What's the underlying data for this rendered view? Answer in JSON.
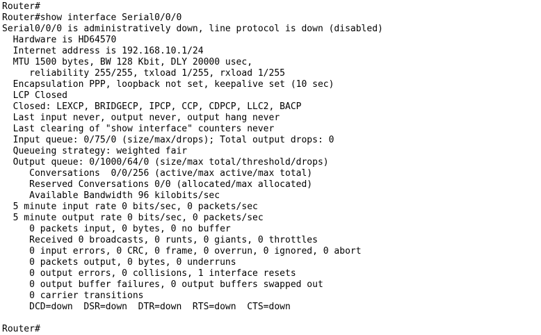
{
  "terminal": {
    "lines": [
      "Router#",
      "Router#show interface Serial0/0/0",
      "Serial0/0/0 is administratively down, line protocol is down (disabled)",
      "  Hardware is HD64570",
      "  Internet address is 192.168.10.1/24",
      "  MTU 1500 bytes, BW 128 Kbit, DLY 20000 usec,",
      "     reliability 255/255, txload 1/255, rxload 1/255",
      "  Encapsulation PPP, loopback not set, keepalive set (10 sec)",
      "  LCP Closed",
      "  Closed: LEXCP, BRIDGECP, IPCP, CCP, CDPCP, LLC2, BACP",
      "  Last input never, output never, output hang never",
      "  Last clearing of \"show interface\" counters never",
      "  Input queue: 0/75/0 (size/max/drops); Total output drops: 0",
      "  Queueing strategy: weighted fair",
      "  Output queue: 0/1000/64/0 (size/max total/threshold/drops)",
      "     Conversations  0/0/256 (active/max active/max total)",
      "     Reserved Conversations 0/0 (allocated/max allocated)",
      "     Available Bandwidth 96 kilobits/sec",
      "  5 minute input rate 0 bits/sec, 0 packets/sec",
      "  5 minute output rate 0 bits/sec, 0 packets/sec",
      "     0 packets input, 0 bytes, 0 no buffer",
      "     Received 0 broadcasts, 0 runts, 0 giants, 0 throttles",
      "     0 input errors, 0 CRC, 0 frame, 0 overrun, 0 ignored, 0 abort",
      "     0 packets output, 0 bytes, 0 underruns",
      "     0 output errors, 0 collisions, 1 interface resets",
      "     0 output buffer failures, 0 output buffers swapped out",
      "     0 carrier transitions",
      "     DCD=down  DSR=down  DTR=down  RTS=down  CTS=down",
      "",
      "Router#"
    ]
  }
}
